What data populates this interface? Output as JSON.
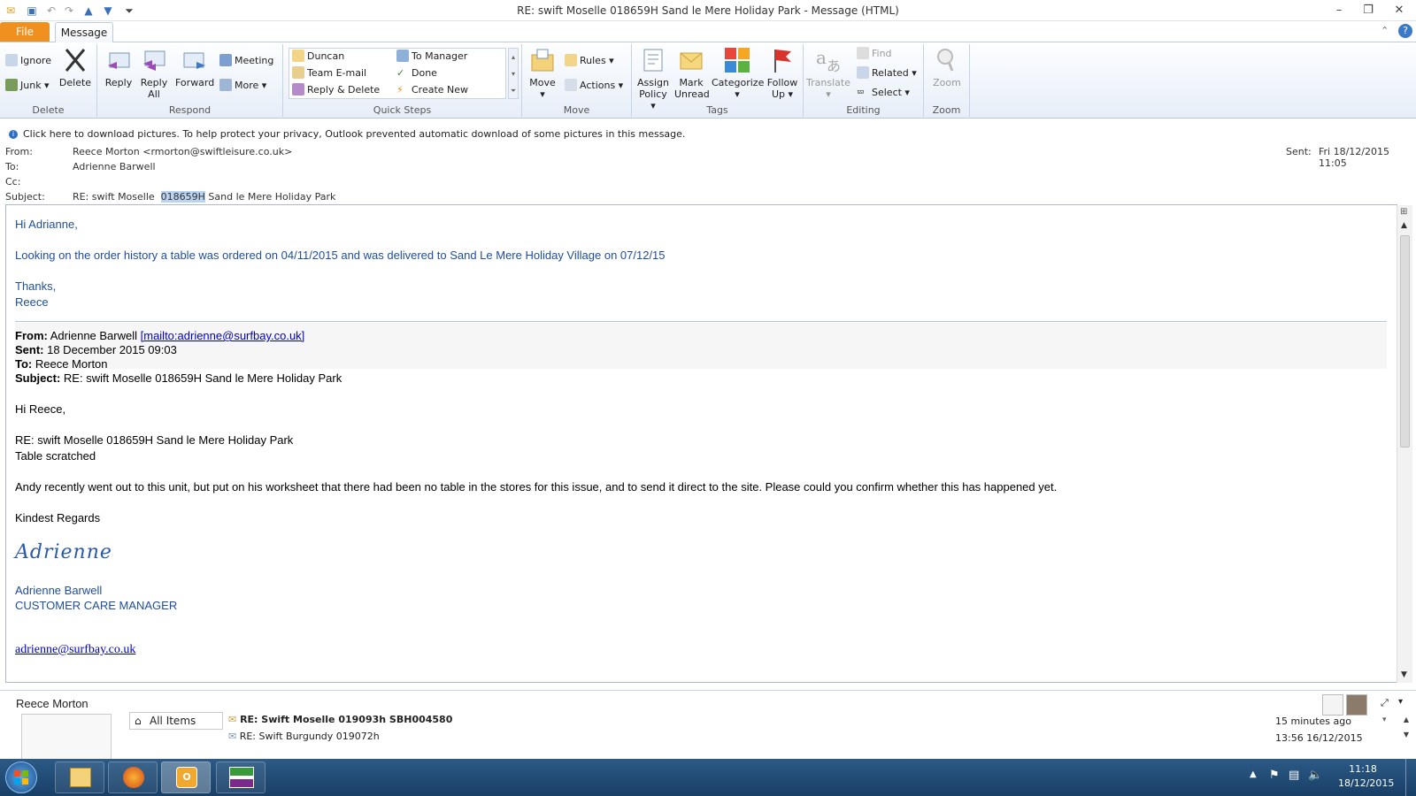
{
  "window": {
    "title": "RE: swift Moselle  018659H Sand le Mere Holiday Park  -  Message (HTML)"
  },
  "tabs": {
    "file": "File",
    "message": "Message"
  },
  "ribbon": {
    "delete": {
      "ignore": "Ignore",
      "junk": "Junk",
      "delete": "Delete",
      "label": "Delete"
    },
    "respond": {
      "reply": "Reply",
      "reply_all_1": "Reply",
      "reply_all_2": "All",
      "forward": "Forward",
      "meeting": "Meeting",
      "more": "More",
      "label": "Respond"
    },
    "quick_steps": {
      "duncan": "Duncan",
      "team_email": "Team E-mail",
      "reply_delete": "Reply & Delete",
      "to_manager": "To Manager",
      "done": "Done",
      "create_new": "Create New",
      "label": "Quick Steps"
    },
    "move": {
      "move": "Move",
      "rules": "Rules",
      "actions": "Actions",
      "label": "Move"
    },
    "tags": {
      "assign_1": "Assign",
      "assign_2": "Policy",
      "mark_1": "Mark",
      "mark_2": "Unread",
      "categorize": "Categorize",
      "follow_1": "Follow",
      "follow_2": "Up",
      "label": "Tags"
    },
    "editing": {
      "translate": "Translate",
      "find": "Find",
      "related": "Related",
      "select": "Select",
      "label": "Editing"
    },
    "zoom": {
      "zoom": "Zoom",
      "label": "Zoom"
    }
  },
  "infobar": {
    "text": "Click here to download pictures. To help protect your privacy, Outlook prevented automatic download of some pictures in this message."
  },
  "header": {
    "from_label": "From:",
    "from_value": "Reece Morton <rmorton@swiftleisure.co.uk>",
    "to_label": "To:",
    "to_value": "Adrienne Barwell",
    "cc_label": "Cc:",
    "subject_label": "Subject:",
    "subject_pre": "RE: swift Moselle  ",
    "subject_highlight": "018659H",
    "subject_post": " Sand le Mere Holiday Park",
    "sent_label": "Sent:",
    "sent_value": "Fri 18/12/2015 11:05"
  },
  "body": {
    "greeting": "Hi Adrianne,",
    "line1": "Looking on the order history a table was ordered on 04/11/2015 and was delivered to Sand Le Mere Holiday Village on 07/12/15",
    "thanks": "Thanks,",
    "signoff": "Reece",
    "quoted": {
      "from_label": "From:",
      "from_value": " Adrienne Barwell ",
      "from_link": "[mailto:adrienne@surfbay.co.uk]",
      "sent_label": "Sent:",
      "sent_value": " 18 December 2015 09:03",
      "to_label": "To:",
      "to_value": " Reece Morton",
      "subject_label": "Subject:",
      "subject_value": " RE: swift Moselle 018659H Sand le Mere Holiday Park",
      "greeting": "Hi Reece,",
      "re_line": "RE: swift Moselle 018659H Sand le Mere Holiday Park",
      "issue": "Table scratched",
      "para": "Andy recently went out to this unit, but put on his worksheet that there had been no table in the stores for this issue, and to send it direct to the site.  Please could you confirm whether this has happened yet.",
      "regards": "Kindest Regards",
      "signature": "Adrienne",
      "name": "Adrienne Barwell",
      "role": "CUSTOMER CARE MANAGER",
      "email": "adrienne@surfbay.co.uk"
    }
  },
  "people_pane": {
    "name": "Reece Morton",
    "all_items": "All Items",
    "item1_subject": "RE: Swift Moselle 019093h SBH004580",
    "item1_time": "15 minutes ago",
    "item2_subject": "RE: Swift Burgundy 019072h",
    "item2_time": "13:56  16/12/2015"
  },
  "taskbar": {
    "time": "11:18",
    "date": "18/12/2015"
  }
}
